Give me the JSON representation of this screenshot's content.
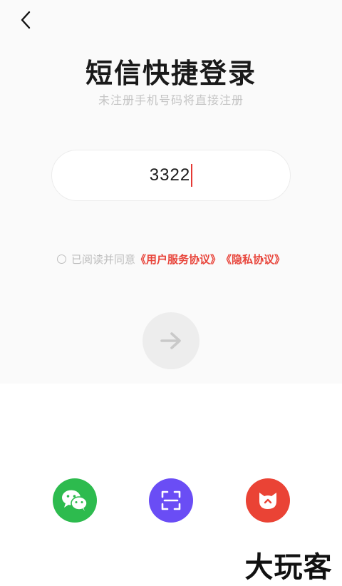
{
  "header": {
    "back_icon": "chevron-left-icon"
  },
  "login": {
    "title": "短信快捷登录",
    "subtitle": "未注册手机号码将直接注册",
    "phone_value": "3322"
  },
  "agreement": {
    "prefix": "已阅读并同意",
    "user_service": "《用户服务协议》",
    "privacy": "《隐私协议》"
  },
  "submit": {
    "icon": "arrow-right-icon"
  },
  "social": {
    "wechat": {
      "icon": "wechat-icon",
      "color": "#2dbb4e"
    },
    "scan": {
      "icon": "scan-icon",
      "color": "#6a4df5"
    },
    "brand": {
      "icon": "cat-face-icon",
      "color": "#ea4335"
    }
  },
  "watermark": {
    "text": "大玩客"
  },
  "colors": {
    "accent": "#e8443a",
    "caret": "#e53935"
  }
}
